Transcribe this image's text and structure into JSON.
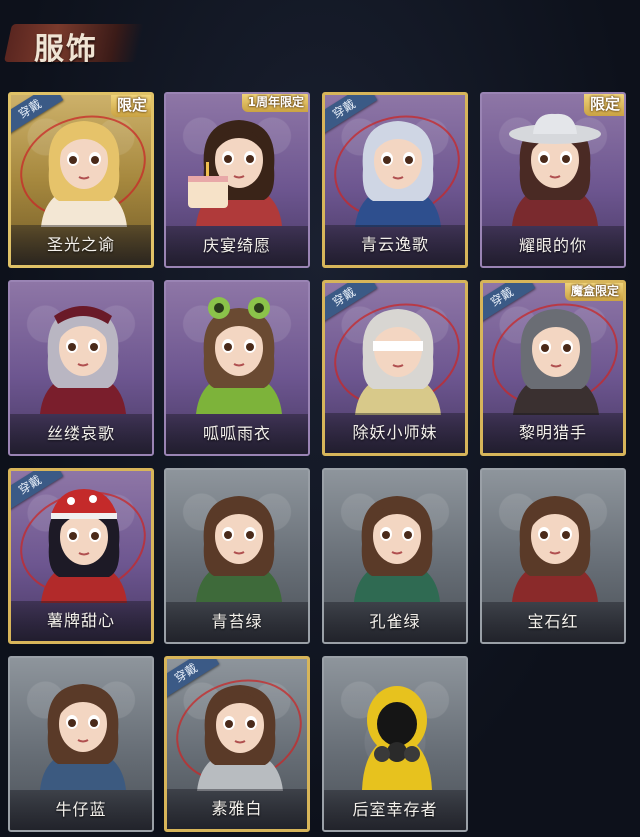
{
  "page_title": "服饰",
  "worn_label": "穿戴",
  "cards": [
    {
      "name": "圣光之谕",
      "tag": "限定",
      "worn": true,
      "theme": "gold",
      "icon": "blonde-queen-portrait"
    },
    {
      "name": "庆宴绮愿",
      "tag": "1周年限定",
      "worn": false,
      "theme": "purple",
      "icon": "cake-boy-portrait"
    },
    {
      "name": "青云逸歌",
      "tag": "",
      "worn": true,
      "theme": "gold-purple",
      "icon": "silver-hair-portrait"
    },
    {
      "name": "耀眼的你",
      "tag": "限定",
      "worn": false,
      "theme": "purple",
      "icon": "cowboy-hat-portrait"
    },
    {
      "name": "丝缕哀歌",
      "tag": "",
      "worn": false,
      "theme": "purple",
      "icon": "gothic-lolita-portrait"
    },
    {
      "name": "呱呱雨衣",
      "tag": "",
      "worn": false,
      "theme": "purple",
      "icon": "frog-hood-portrait"
    },
    {
      "name": "除妖小师妹",
      "tag": "",
      "worn": true,
      "theme": "gold-purple",
      "icon": "blindfold-portrait"
    },
    {
      "name": "黎明猎手",
      "tag": "魔盒限定",
      "worn": true,
      "theme": "gold-purple",
      "icon": "hunter-portrait"
    },
    {
      "name": "薯牌甜心",
      "tag": "",
      "worn": true,
      "theme": "gold-purple",
      "icon": "red-cap-girl-portrait"
    },
    {
      "name": "青苔绿",
      "tag": "",
      "worn": false,
      "theme": "gray",
      "icon": "green-dress-portrait"
    },
    {
      "name": "孔雀绿",
      "tag": "",
      "worn": false,
      "theme": "gray",
      "icon": "teal-dress-portrait"
    },
    {
      "name": "宝石红",
      "tag": "",
      "worn": false,
      "theme": "gray",
      "icon": "red-dress-portrait"
    },
    {
      "name": "牛仔蓝",
      "tag": "",
      "worn": false,
      "theme": "gray",
      "icon": "denim-dress-portrait"
    },
    {
      "name": "素雅白",
      "tag": "",
      "worn": true,
      "theme": "gray-gold",
      "icon": "white-dress-portrait"
    },
    {
      "name": "后室幸存者",
      "tag": "",
      "worn": false,
      "theme": "gray",
      "icon": "hazmat-mask-portrait"
    }
  ],
  "colors": {
    "worn_badge": "#3b5a86",
    "limited_tag": "#caa242",
    "ring": "#c82828"
  }
}
